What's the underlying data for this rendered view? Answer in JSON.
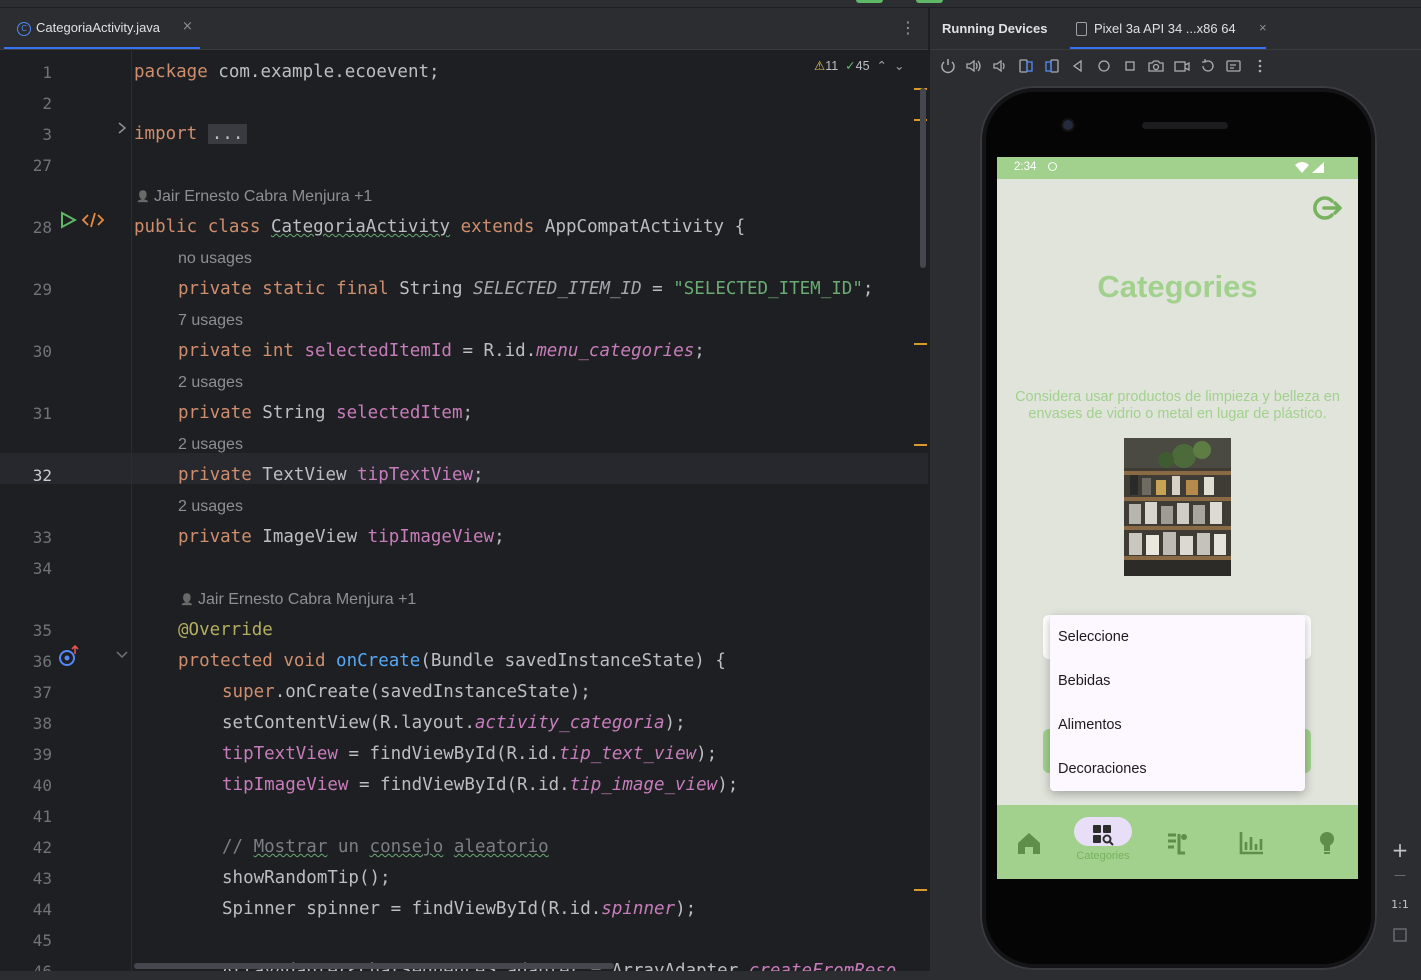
{
  "editor": {
    "tab": {
      "icon": "class-icon",
      "label": "CategoriaActivity.java",
      "close": "×"
    },
    "menu_glyph": "⋮",
    "inspections": {
      "warnings": "11",
      "ok": "45"
    },
    "current_line": "32",
    "lines": [
      {
        "no": "1",
        "parts": [
          [
            "kw",
            "package "
          ],
          [
            "plain",
            "com.example.ecoevent;"
          ]
        ]
      },
      {
        "no": "2",
        "parts": []
      },
      {
        "no": "3",
        "parts": [
          [
            "kw",
            "import "
          ],
          [
            "fold",
            "..."
          ]
        ]
      },
      {
        "no": "27",
        "parts": []
      },
      {
        "hint": "Jair Ernesto Cabra Menjura +1",
        "indent": 0
      },
      {
        "no": "28",
        "parts": [
          [
            "kw",
            "public class "
          ],
          [
            "plainu",
            "CategoriaActivity"
          ],
          [
            "kw",
            " extends "
          ],
          [
            "plain",
            "AppCompatActivity {"
          ]
        ]
      },
      {
        "hint": "no usages",
        "indent": 1
      },
      {
        "no": "29",
        "indent": 1,
        "parts": [
          [
            "kw",
            "private static final "
          ],
          [
            "plain",
            "String "
          ],
          [
            "sti",
            "SELECTED_ITEM_ID"
          ],
          [
            "plain",
            " = "
          ],
          [
            "str",
            "\"SELECTED_ITEM_ID\""
          ],
          [
            "plain",
            ";"
          ]
        ]
      },
      {
        "hint": "7 usages",
        "indent": 1
      },
      {
        "no": "30",
        "indent": 1,
        "parts": [
          [
            "kw",
            "private int "
          ],
          [
            "fld",
            "selectedItemId"
          ],
          [
            "plain",
            " = R.id."
          ],
          [
            "fldi",
            "menu_categories"
          ],
          [
            "plain",
            ";"
          ]
        ]
      },
      {
        "hint": "2 usages",
        "indent": 1
      },
      {
        "no": "31",
        "indent": 1,
        "parts": [
          [
            "kw",
            "private "
          ],
          [
            "plain",
            "String "
          ],
          [
            "fld",
            "selectedItem"
          ],
          [
            "plain",
            ";"
          ]
        ]
      },
      {
        "hint": "2 usages",
        "indent": 1
      },
      {
        "no": "32",
        "indent": 1,
        "parts": [
          [
            "kw",
            "private "
          ],
          [
            "plain",
            "TextView "
          ],
          [
            "fld",
            "tipTextView"
          ],
          [
            "plain",
            ";"
          ]
        ]
      },
      {
        "hint": "2 usages",
        "indent": 1
      },
      {
        "no": "33",
        "indent": 1,
        "parts": [
          [
            "kw",
            "private "
          ],
          [
            "plain",
            "ImageView "
          ],
          [
            "fld",
            "tipImageView"
          ],
          [
            "plain",
            ";"
          ]
        ]
      },
      {
        "no": "34",
        "parts": []
      },
      {
        "hint": "Jair Ernesto Cabra Menjura +1",
        "indent": 1
      },
      {
        "no": "35",
        "indent": 1,
        "parts": [
          [
            "ann",
            "@Override"
          ]
        ]
      },
      {
        "no": "36",
        "indent": 1,
        "parts": [
          [
            "kw",
            "protected void "
          ],
          [
            "fn",
            "onCreate"
          ],
          [
            "plain",
            "(Bundle savedInstanceState) {"
          ]
        ]
      },
      {
        "no": "37",
        "indent": 2,
        "parts": [
          [
            "kw",
            "super"
          ],
          [
            "plain",
            ".onCreate(savedInstanceState);"
          ]
        ]
      },
      {
        "no": "38",
        "indent": 2,
        "parts": [
          [
            "plain",
            "setContentView(R.layout."
          ],
          [
            "fldi",
            "activity_categoria"
          ],
          [
            "plain",
            ");"
          ]
        ]
      },
      {
        "no": "39",
        "indent": 2,
        "parts": [
          [
            "fld",
            "tipTextView"
          ],
          [
            "plain",
            " = findViewById(R.id."
          ],
          [
            "fldi",
            "tip_text_view"
          ],
          [
            "plain",
            ");"
          ]
        ]
      },
      {
        "no": "40",
        "indent": 2,
        "parts": [
          [
            "fld",
            "tipImageView"
          ],
          [
            "plain",
            " = findViewById(R.id."
          ],
          [
            "fldi",
            "tip_image_view"
          ],
          [
            "plain",
            ");"
          ]
        ]
      },
      {
        "no": "41",
        "parts": []
      },
      {
        "no": "42",
        "indent": 2,
        "parts": [
          [
            "cmt",
            "// "
          ],
          [
            "cmtu",
            "Mostrar"
          ],
          [
            "cmt",
            " un "
          ],
          [
            "cmtu",
            "consejo"
          ],
          [
            "cmt",
            " "
          ],
          [
            "cmtu",
            "aleatorio"
          ]
        ]
      },
      {
        "no": "43",
        "indent": 2,
        "parts": [
          [
            "plain",
            "showRandomTip();"
          ]
        ]
      },
      {
        "no": "44",
        "indent": 2,
        "parts": [
          [
            "plain",
            "Spinner spinner = findViewById(R.id."
          ],
          [
            "fldi",
            "spinner"
          ],
          [
            "plain",
            ");"
          ]
        ]
      },
      {
        "no": "45",
        "parts": []
      },
      {
        "no": "46",
        "indent": 2,
        "parts": [
          [
            "plain",
            "ArrayAdapter<CharSequence> adapter = ArrayAdapter."
          ],
          [
            "fldi",
            "createFromReso"
          ]
        ]
      }
    ]
  },
  "running_devices": {
    "title": "Running Devices",
    "device_tab": "Pixel 3a API 34 ...x86 64",
    "close": "×",
    "toolbar_icons": [
      "power-icon",
      "volume-up-icon",
      "volume-down-icon",
      "rotate-left-icon",
      "rotate-right-icon",
      "back-icon",
      "home-icon",
      "overview-icon",
      "screenshot-icon",
      "screen-record-icon",
      "reset-icon",
      "snapshot-icon",
      "more-icon"
    ],
    "zoom": {
      "plus": "+",
      "minus": "—",
      "ratio": "1:1"
    }
  },
  "device": {
    "status_time": "2:34",
    "title": "Categories",
    "tip": "Considera usar productos de limpieza y belleza en envases de vidrio o metal en lugar de plástico.",
    "dropdown_options": [
      "Seleccione",
      "Bebidas",
      "Alimentos",
      "Decoraciones"
    ],
    "nav_active_label": "Categories",
    "nav_icons": [
      "home-icon",
      "categories-search-icon",
      "event-list-icon",
      "chart-icon",
      "lightbulb-icon"
    ]
  },
  "colors": {
    "accent_green": "#a2d18d",
    "editor_bg": "#1e1f22",
    "keyword": "#cf8e6d",
    "field": "#c77dbb",
    "string": "#6aab73"
  }
}
